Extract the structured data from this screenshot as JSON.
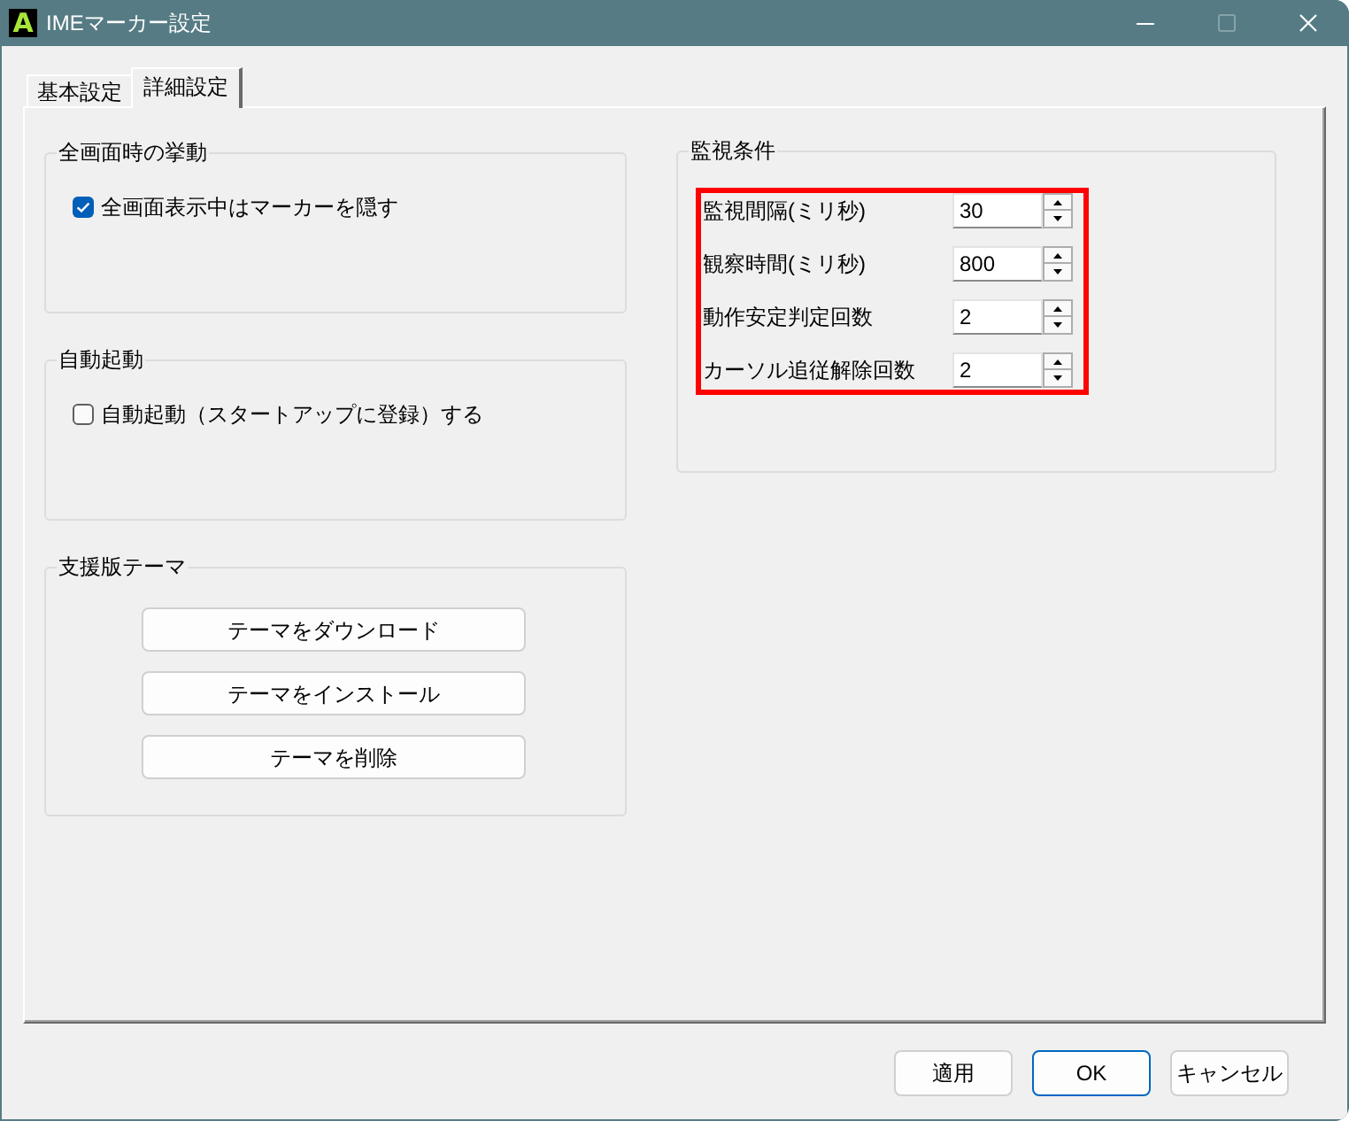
{
  "window": {
    "logo_text": "A",
    "title": "IMEマーカー設定",
    "controls": [
      {
        "kind": "minimize",
        "disabled": false
      },
      {
        "kind": "maximize",
        "disabled": true
      },
      {
        "kind": "close",
        "disabled": false
      }
    ]
  },
  "tabs": [
    {
      "label": "基本設定",
      "selected": false
    },
    {
      "label": "詳細設定",
      "selected": true
    }
  ],
  "left_groups": [
    {
      "kind": "checkbox",
      "title": "全画面時の挙動",
      "label": "全画面表示中はマーカーを隠す",
      "checked": true
    },
    {
      "kind": "checkbox",
      "title": "自動起動",
      "label": "自動起動（スタートアップに登録）する",
      "checked": false
    },
    {
      "kind": "buttons",
      "title": "支援版テーマ",
      "buttons": [
        "テーマをダウンロード",
        "テーマをインストール",
        "テーマを削除"
      ]
    }
  ],
  "monitor_group": {
    "title": "監視条件",
    "highlighted": true,
    "fields": [
      {
        "label": "監視間隔(ミリ秒)",
        "value": "30"
      },
      {
        "label": "観察時間(ミリ秒)",
        "value": "800"
      },
      {
        "label": "動作安定判定回数",
        "value": "2"
      },
      {
        "label": "カーソル追従解除回数",
        "value": "2"
      }
    ]
  },
  "buttons": [
    {
      "label": "適用",
      "focused": false
    },
    {
      "label": "OK",
      "focused": true
    },
    {
      "label": "キャンセル",
      "focused": false
    }
  ]
}
